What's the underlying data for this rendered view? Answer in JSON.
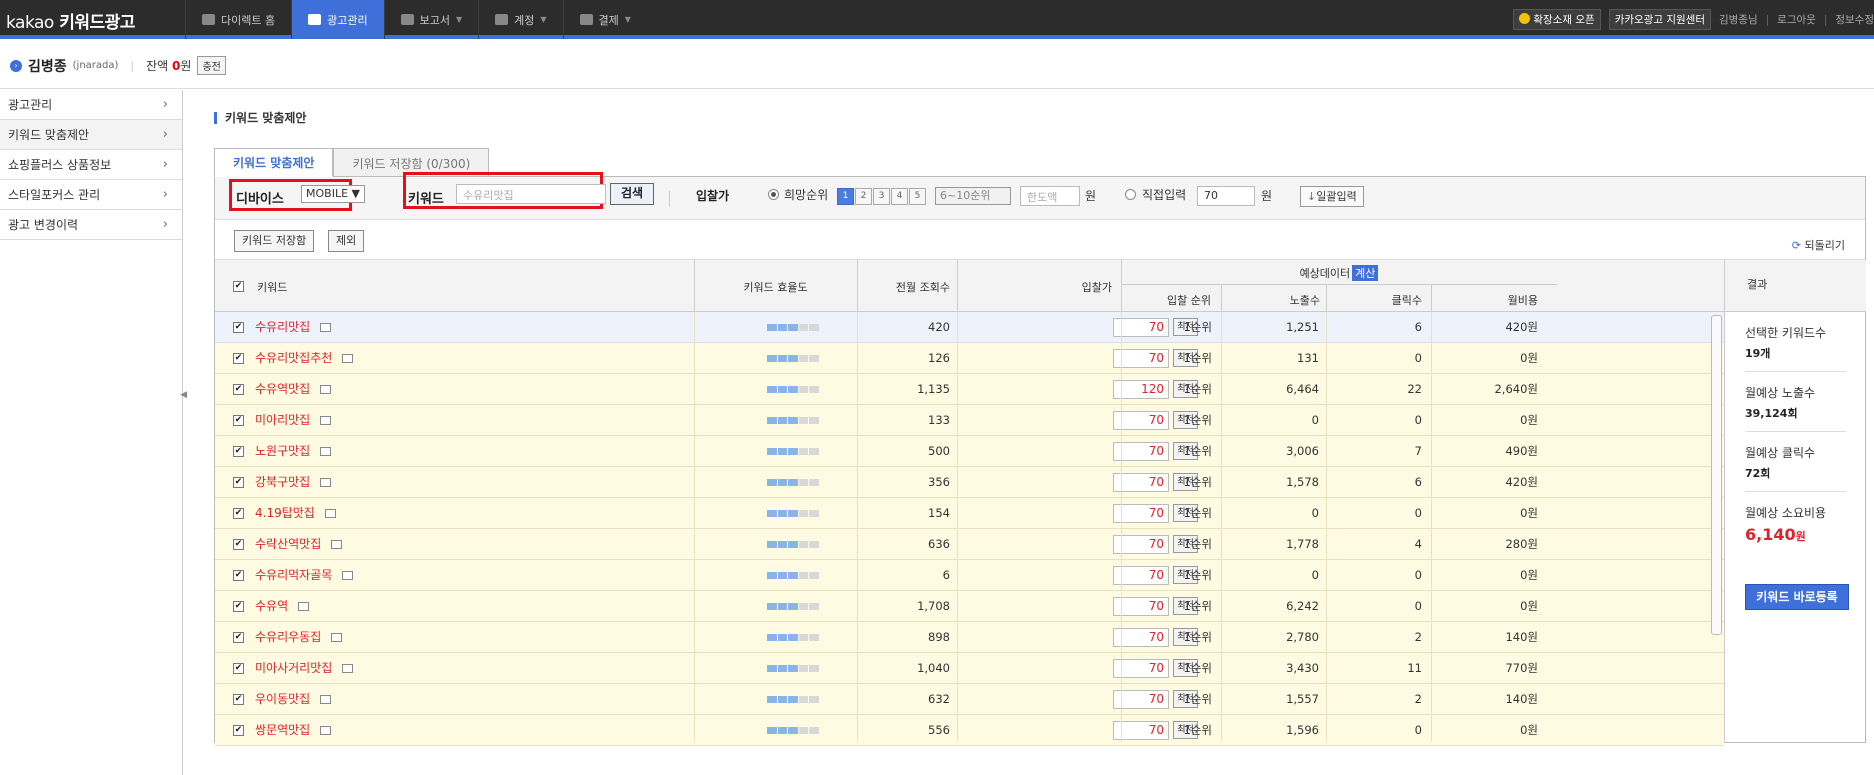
{
  "header": {
    "logo_brand": "kakao",
    "logo_product": "키워드광고",
    "nav": [
      {
        "label": "다이렉트 홈",
        "icon": "home-icon"
      },
      {
        "label": "광고관리",
        "icon": "gear-icon"
      },
      {
        "label": "보고서",
        "icon": "chart-icon"
      },
      {
        "label": "계정",
        "icon": "person-icon"
      },
      {
        "label": "결제",
        "icon": "database-icon"
      }
    ],
    "notice_label": "확장소재 오픈",
    "support_label": "카카오광고 지원센터",
    "user_greeting": "김병종님",
    "logout": "로그아웃",
    "info_edit": "정보수정"
  },
  "userbar": {
    "name": "김병종",
    "id": "(jnarada)",
    "balance_label": "잔액",
    "balance_value": "0",
    "balance_unit": "원",
    "charge_button": "충전"
  },
  "sidebar": {
    "items": [
      "광고관리",
      "키워드 맞춤제안",
      "쇼핑플러스 상품정보",
      "스타일포커스 관리",
      "광고 변경이력"
    ]
  },
  "page": {
    "title": "키워드 맞춤제안",
    "tabs": [
      "키워드 맞춤제안",
      "키워드 저장함 (0/300)"
    ]
  },
  "filter": {
    "device_label": "디바이스",
    "device_value": "MOBILE ▼",
    "keyword_label": "키워드",
    "keyword_placeholder": "수유리맛집",
    "search_button": "검색",
    "bid_label": "입찰가",
    "rank_radio_label": "희망순위",
    "rank_buttons": [
      "1",
      "2",
      "3",
      "4",
      "5"
    ],
    "rank_select": "6~10순위",
    "limit_placeholder": "한도액",
    "unit_won": "원",
    "direct_label": "직접입력",
    "direct_value": "70",
    "bulk_button": "일괄입력"
  },
  "actions": {
    "save_button": "키워드 저장함",
    "exclude_button": "제외",
    "reset_label": "되돌리기"
  },
  "table": {
    "headers": {
      "keyword": "키워드",
      "efficiency": "키워드 효율도",
      "monthly_views": "전월 조회수",
      "bid": "입찰가",
      "forecast": "예상데이터",
      "calc": "계산",
      "rank": "입찰 순위",
      "impressions": "노출수",
      "clicks": "클릭수",
      "monthly_cost": "월비용"
    },
    "min_label": "최저",
    "rows": [
      {
        "keyword": "수유리맛집",
        "views": "420",
        "bid": "70",
        "rank": "1순위",
        "impressions": "1,251",
        "clicks": "6",
        "cost": "420원"
      },
      {
        "keyword": "수유리맛집추천",
        "views": "126",
        "bid": "70",
        "rank": "1순위",
        "impressions": "131",
        "clicks": "0",
        "cost": "0원"
      },
      {
        "keyword": "수유역맛집",
        "views": "1,135",
        "bid": "120",
        "rank": "1순위",
        "impressions": "6,464",
        "clicks": "22",
        "cost": "2,640원"
      },
      {
        "keyword": "미아리맛집",
        "views": "133",
        "bid": "70",
        "rank": "1순위",
        "impressions": "0",
        "clicks": "0",
        "cost": "0원"
      },
      {
        "keyword": "노원구맛집",
        "views": "500",
        "bid": "70",
        "rank": "1순위",
        "impressions": "3,006",
        "clicks": "7",
        "cost": "490원"
      },
      {
        "keyword": "강북구맛집",
        "views": "356",
        "bid": "70",
        "rank": "1순위",
        "impressions": "1,578",
        "clicks": "6",
        "cost": "420원"
      },
      {
        "keyword": "4.19탑맛집",
        "views": "154",
        "bid": "70",
        "rank": "1순위",
        "impressions": "0",
        "clicks": "0",
        "cost": "0원"
      },
      {
        "keyword": "수락산역맛집",
        "views": "636",
        "bid": "70",
        "rank": "1순위",
        "impressions": "1,778",
        "clicks": "4",
        "cost": "280원"
      },
      {
        "keyword": "수유리먹자골목",
        "views": "6",
        "bid": "70",
        "rank": "1순위",
        "impressions": "0",
        "clicks": "0",
        "cost": "0원"
      },
      {
        "keyword": "수유역",
        "views": "1,708",
        "bid": "70",
        "rank": "1순위",
        "impressions": "6,242",
        "clicks": "0",
        "cost": "0원"
      },
      {
        "keyword": "수유리우동집",
        "views": "898",
        "bid": "70",
        "rank": "1순위",
        "impressions": "2,780",
        "clicks": "2",
        "cost": "140원"
      },
      {
        "keyword": "미아사거리맛집",
        "views": "1,040",
        "bid": "70",
        "rank": "1순위",
        "impressions": "3,430",
        "clicks": "11",
        "cost": "770원"
      },
      {
        "keyword": "우이동맛집",
        "views": "632",
        "bid": "70",
        "rank": "1순위",
        "impressions": "1,557",
        "clicks": "2",
        "cost": "140원"
      },
      {
        "keyword": "쌍문역맛집",
        "views": "556",
        "bid": "70",
        "rank": "1순위",
        "impressions": "1,596",
        "clicks": "0",
        "cost": "0원"
      }
    ]
  },
  "result": {
    "header": "결과",
    "selected_label": "선택한 키워드수",
    "selected_value": "19개",
    "impr_label": "월예상 노출수",
    "impr_value": "39,124회",
    "click_label": "월예상 클릭수",
    "click_value": "72회",
    "cost_label": "월예상 소요비용",
    "cost_value": "6,140",
    "cost_unit": "원",
    "register_button": "키워드 바로등록"
  },
  "colors": {
    "accent": "#3f6fd8",
    "keyword_red": "#e2222b",
    "highlight_box": "#e3111c"
  }
}
